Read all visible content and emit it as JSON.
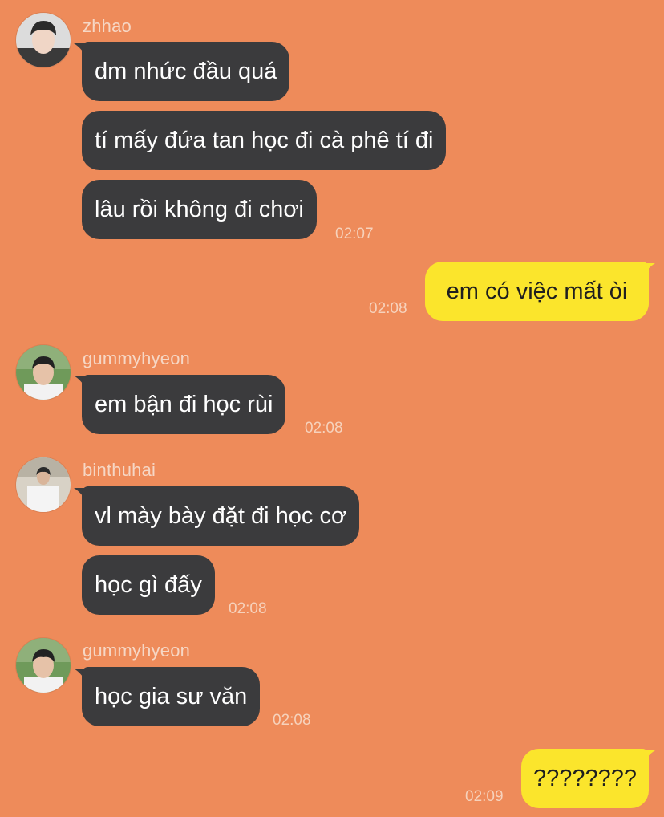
{
  "messages": {
    "m1": {
      "sender": "zhhao",
      "lines": [
        "dm nhức đầu quá",
        "tí mấy đứa tan học đi cà phê tí đi",
        "lâu rồi không đi chơi"
      ],
      "time": "02:07"
    },
    "m2": {
      "text": "em có việc mất òi",
      "time": "02:08"
    },
    "m3": {
      "sender": "gummyhyeon",
      "lines": [
        "em bận đi học rùi"
      ],
      "time": "02:08"
    },
    "m4": {
      "sender": "binthuhai",
      "lines": [
        "vl mày bày đặt đi học cơ",
        "học gì đấy"
      ],
      "time": "02:08"
    },
    "m5": {
      "sender": "gummyhyeon",
      "lines": [
        "học gia sư văn"
      ],
      "time": "02:08"
    },
    "m6": {
      "text": "????????",
      "time": "02:09"
    }
  },
  "colors": {
    "background": "#ee8b5a",
    "incoming_bubble": "#3b3b3d",
    "outgoing_bubble": "#fbe52c",
    "incoming_text": "#ffffff",
    "outgoing_text": "#1f1f1f",
    "meta_text": "#f6d2bc"
  },
  "icons": {
    "avatar_zhhao": "profile-photo",
    "avatar_gummyhyeon": "profile-photo",
    "avatar_binthuhai": "profile-photo"
  }
}
